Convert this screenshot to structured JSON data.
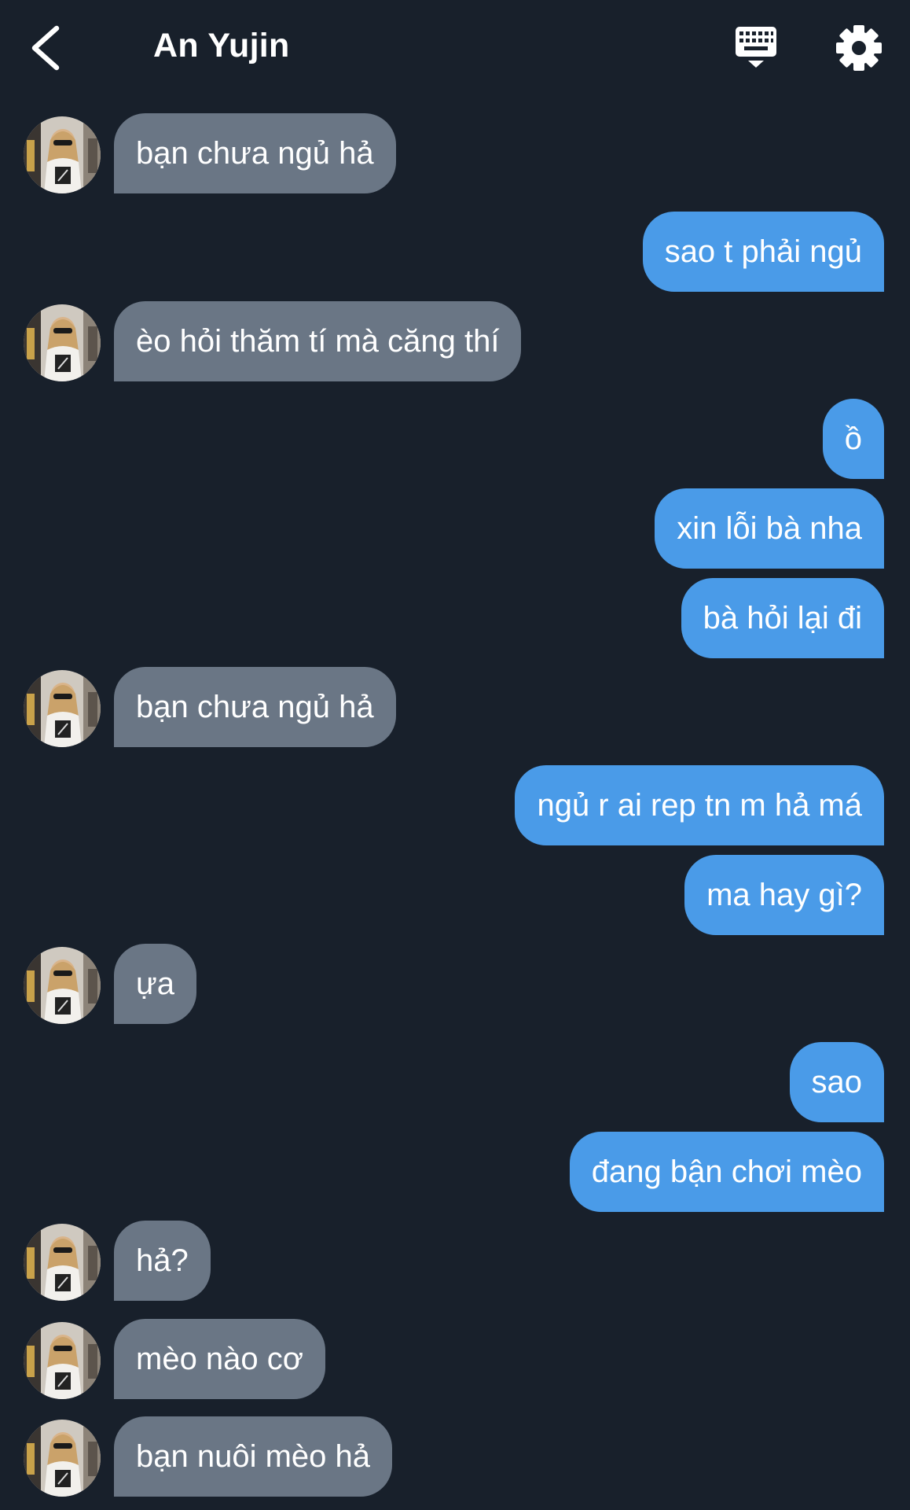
{
  "header": {
    "title": "An Yujin"
  },
  "colors": {
    "background": "#18202b",
    "incoming_bubble": "#6a7685",
    "outgoing_bubble": "#4a9be8",
    "text": "#ffffff"
  },
  "icons": {
    "back": "chevron-left-icon",
    "keyboard": "keyboard-icon",
    "settings": "gear-icon",
    "avatar": "contact-avatar"
  },
  "messages": [
    {
      "from": "them",
      "text": "bạn chưa ngủ hả"
    },
    {
      "from": "me",
      "text": "sao t phải ngủ"
    },
    {
      "from": "them",
      "text": "èo hỏi thăm tí mà căng thí"
    },
    {
      "from": "me",
      "text": "ồ"
    },
    {
      "from": "me",
      "text": "xin lỗi bà nha"
    },
    {
      "from": "me",
      "text": "bà hỏi lại đi"
    },
    {
      "from": "them",
      "text": "bạn chưa ngủ hả"
    },
    {
      "from": "me",
      "text": "ngủ r ai rep tn m hả má"
    },
    {
      "from": "me",
      "text": "ma hay gì?"
    },
    {
      "from": "them",
      "text": "ựa"
    },
    {
      "from": "me",
      "text": "sao"
    },
    {
      "from": "me",
      "text": "đang bận chơi mèo"
    },
    {
      "from": "them",
      "text": "hả?"
    },
    {
      "from": "them",
      "text": "mèo nào cơ"
    },
    {
      "from": "them",
      "text": "bạn nuôi mèo hả"
    }
  ]
}
